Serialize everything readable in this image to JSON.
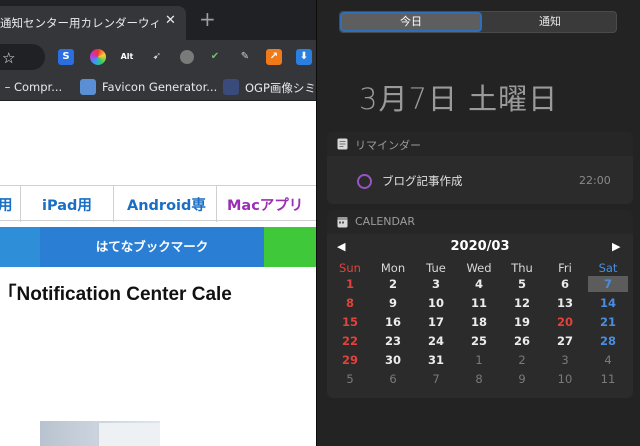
{
  "browser": {
    "tab_title": "通知センター用カレンダーウィジェ",
    "tab_close": "✕",
    "new_tab": "+",
    "bookmarks": [
      {
        "label": "G – Compr..."
      },
      {
        "label": "Favicon Generator..."
      },
      {
        "label": "OGP画像シミ"
      }
    ],
    "categories": [
      "用",
      "iPad用",
      "Android専",
      "Macアプリ"
    ],
    "share_hatena": "はてなブックマーク",
    "article_title": "・「Notification Center Cale"
  },
  "colors": {
    "accent_blue": "#1a6fc4",
    "mac_purple": "#9b2fb4",
    "sunday_red": "#e0433b",
    "saturday_blue": "#4a8de0",
    "reminder_purple": "#9b52c9"
  },
  "nc": {
    "tabs": {
      "today": "今日",
      "notifications": "通知"
    },
    "date_heading": "3月7日 土曜日",
    "reminders": {
      "header": "リマインダー",
      "items": [
        {
          "title": "ブログ記事作成",
          "time": "22:00"
        }
      ]
    },
    "calendar": {
      "header": "CALENDAR",
      "prev": "◀",
      "next": "▶",
      "month": "2020/03",
      "weekdays": [
        "Sun",
        "Mon",
        "Tue",
        "Wed",
        "Thu",
        "Fri",
        "Sat"
      ],
      "weeks": [
        [
          "1",
          "2",
          "3",
          "4",
          "5",
          "6",
          "7"
        ],
        [
          "8",
          "9",
          "10",
          "11",
          "12",
          "13",
          "14"
        ],
        [
          "15",
          "16",
          "17",
          "18",
          "19",
          "20",
          "21"
        ],
        [
          "22",
          "23",
          "24",
          "25",
          "26",
          "27",
          "28"
        ],
        [
          "29",
          "30",
          "31",
          "1",
          "2",
          "3",
          "4"
        ],
        [
          "5",
          "6",
          "7",
          "8",
          "9",
          "10",
          "11"
        ]
      ],
      "today": "7",
      "holiday": "20"
    }
  }
}
